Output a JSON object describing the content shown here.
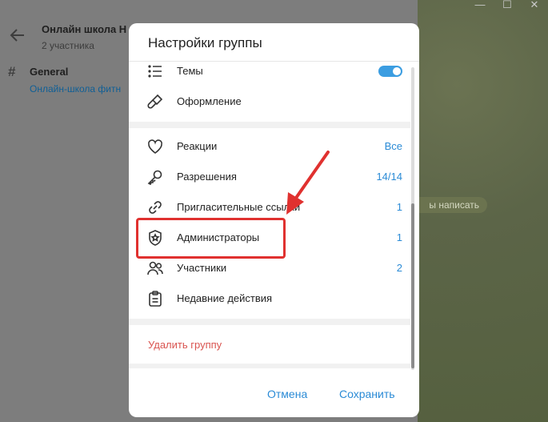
{
  "window": {
    "minimize": "—",
    "maximize": "☐",
    "close": "✕"
  },
  "chat": {
    "title": "Онлайн школа Н",
    "subtitle": "2 участника",
    "topic_title": "General",
    "topic_subtitle": "Онлайн-школа фитн",
    "write_hint": "ы написать"
  },
  "dialog": {
    "title": "Настройки группы",
    "items": [
      {
        "icon": "list-icon",
        "label": "Темы",
        "value": "",
        "toggle": true
      },
      {
        "icon": "brush-icon",
        "label": "Оформление",
        "value": ""
      },
      {
        "icon": "heart-icon",
        "label": "Реакции",
        "value": "Все"
      },
      {
        "icon": "key-icon",
        "label": "Разрешения",
        "value": "14/14"
      },
      {
        "icon": "link-icon",
        "label": "Пригласительные ссылки",
        "value": "1"
      },
      {
        "icon": "shield-star-icon",
        "label": "Администраторы",
        "value": "1"
      },
      {
        "icon": "users-icon",
        "label": "Участники",
        "value": "2"
      },
      {
        "icon": "clipboard-icon",
        "label": "Недавние действия",
        "value": ""
      }
    ],
    "delete_label": "Удалить группу",
    "cancel_label": "Отмена",
    "save_label": "Сохранить"
  },
  "colors": {
    "accent": "#2b8bd6",
    "danger": "#d9534f",
    "annotation": "#e0312f",
    "toggle_on": "#3b9de1"
  }
}
